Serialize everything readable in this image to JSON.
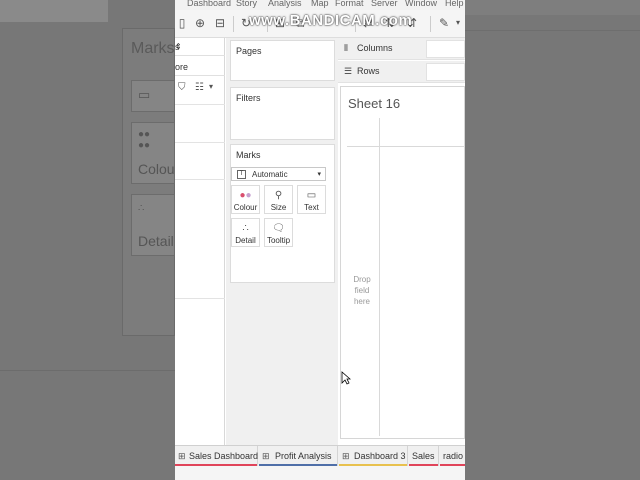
{
  "watermark": "www.BANDICAM.com",
  "menu": [
    "Dashboard",
    "Story",
    "Analysis",
    "Map",
    "Format",
    "Server",
    "Window",
    "Help"
  ],
  "data_pane": {
    "header_fragment": "s",
    "search_fragment": "ore"
  },
  "shelves": {
    "pages_label": "Pages",
    "filters_label": "Filters",
    "marks_label": "Marks",
    "mark_type": "Automatic",
    "mark_buttons": {
      "colour": "Colour",
      "size": "Size",
      "text": "Text",
      "detail": "Detail",
      "tooltip": "Tooltip"
    }
  },
  "columns_label": "Columns",
  "rows_label": "Rows",
  "sheet": {
    "title": "Sheet 16",
    "drop_hint_lines": [
      "Drop",
      "field",
      "here"
    ]
  },
  "tabs": [
    {
      "label": "Sales Dashboard",
      "color": "#e0445a"
    },
    {
      "label": "Profit Analysis",
      "color": "#4f6fa8"
    },
    {
      "label": "Dashboard 3",
      "color": "#e8c14e"
    },
    {
      "label": "Sales",
      "color": "#e0445a"
    },
    {
      "label": "radio",
      "color": "#e0445a"
    }
  ],
  "background_panel": {
    "title": "Marks",
    "card_labels": [
      "Colour",
      "Detail"
    ]
  }
}
